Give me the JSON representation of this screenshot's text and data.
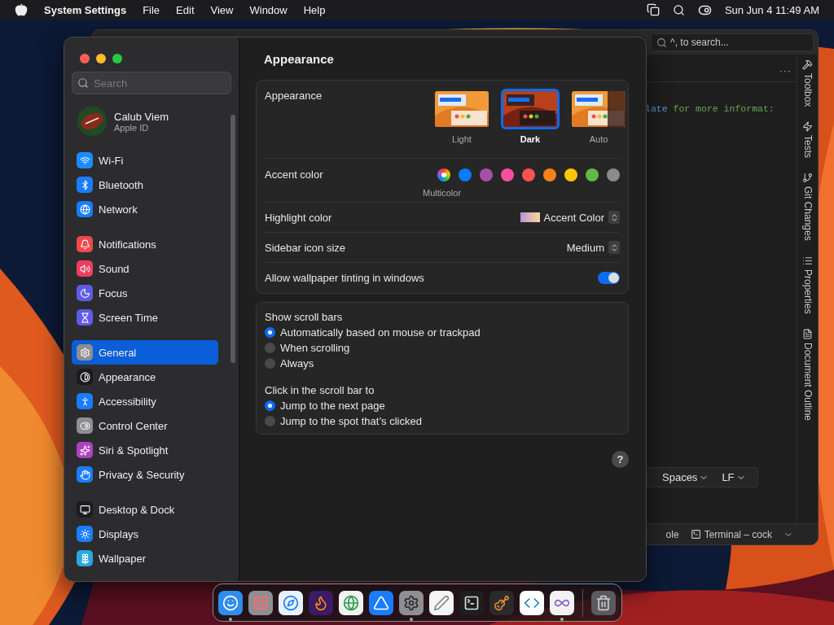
{
  "menubar": {
    "app": "System Settings",
    "menus": [
      "File",
      "Edit",
      "View",
      "Window",
      "Help"
    ],
    "clock": "Sun Jun 4  11:49 AM"
  },
  "ide": {
    "search_placeholder": "^, to search...",
    "more": "···",
    "code": [
      {
        "text": "late",
        "kind": "keyword"
      },
      {
        "text": " for more informat:",
        "kind": "string"
      }
    ],
    "side_tabs": [
      {
        "label": "Toolbox",
        "kind": "toolbox"
      },
      {
        "label": "Tests",
        "kind": "tests"
      },
      {
        "label": "Git Changes",
        "kind": "git"
      },
      {
        "label": "Properties",
        "kind": "properties"
      },
      {
        "label": "Document Outline",
        "kind": "outline"
      }
    ],
    "status": [
      "Spaces",
      "LF"
    ],
    "bottom_tabs": [
      {
        "label": "ole",
        "kind": "plain"
      },
      {
        "label": "Terminal – cock",
        "kind": "terminal"
      }
    ]
  },
  "settings": {
    "search_placeholder": "Search",
    "account": {
      "name": "Calub Viem",
      "subtitle": "Apple ID"
    },
    "sidebar_groups": [
      [
        {
          "label": "Wi-Fi",
          "kind": "wifi",
          "selected": false
        },
        {
          "label": "Bluetooth",
          "kind": "bluetooth",
          "selected": false
        },
        {
          "label": "Network",
          "kind": "network",
          "selected": false
        }
      ],
      [
        {
          "label": "Notifications",
          "kind": "notifications",
          "selected": false
        },
        {
          "label": "Sound",
          "kind": "sound",
          "selected": false
        },
        {
          "label": "Focus",
          "kind": "focus",
          "selected": false
        },
        {
          "label": "Screen Time",
          "kind": "screentime",
          "selected": false
        }
      ],
      [
        {
          "label": "General",
          "kind": "general",
          "selected": true
        },
        {
          "label": "Appearance",
          "kind": "appearance",
          "selected": false
        },
        {
          "label": "Accessibility",
          "kind": "accessibility",
          "selected": false
        },
        {
          "label": "Control Center",
          "kind": "control",
          "selected": false
        },
        {
          "label": "Siri & Spotlight",
          "kind": "siri",
          "selected": false
        },
        {
          "label": "Privacy & Security",
          "kind": "privacy",
          "selected": false
        }
      ],
      [
        {
          "label": "Desktop & Dock",
          "kind": "desktop",
          "selected": false
        },
        {
          "label": "Displays",
          "kind": "displays",
          "selected": false
        },
        {
          "label": "Wallpaper",
          "kind": "wallpaper",
          "selected": false
        }
      ]
    ],
    "title": "Appearance",
    "appearance": {
      "label": "Appearance",
      "options": [
        {
          "label": "Light",
          "kind": "light",
          "selected": false
        },
        {
          "label": "Dark",
          "kind": "dark",
          "selected": true
        },
        {
          "label": "Auto",
          "kind": "auto",
          "selected": false
        }
      ]
    },
    "accent": {
      "label": "Accent color",
      "caption": "Multicolor",
      "colors": [
        {
          "kind": "multicolor",
          "selected": true
        },
        {
          "kind": "solid",
          "color": "#0a7cff",
          "selected": false
        },
        {
          "kind": "solid",
          "color": "#a550a7",
          "selected": false
        },
        {
          "kind": "solid",
          "color": "#f74f9e",
          "selected": false
        },
        {
          "kind": "solid",
          "color": "#ff5257",
          "selected": false
        },
        {
          "kind": "solid",
          "color": "#f7821b",
          "selected": false
        },
        {
          "kind": "solid",
          "color": "#ffc600",
          "selected": false
        },
        {
          "kind": "solid",
          "color": "#62ba46",
          "selected": false
        },
        {
          "kind": "solid",
          "color": "#8c8c8c",
          "selected": false
        }
      ]
    },
    "highlight": {
      "label": "Highlight color",
      "value": "Accent Color"
    },
    "icon_size": {
      "label": "Sidebar icon size",
      "value": "Medium"
    },
    "tinting": {
      "label": "Allow wallpaper tinting in windows",
      "on": true
    },
    "scroll_bars": {
      "label": "Show scroll bars",
      "options": [
        {
          "label": "Automatically based on mouse or trackpad",
          "selected": true
        },
        {
          "label": "When scrolling",
          "selected": false
        },
        {
          "label": "Always",
          "selected": false
        }
      ]
    },
    "click_scroll": {
      "label": "Click in the scroll bar to",
      "options": [
        {
          "label": "Jump to the next page",
          "selected": true
        },
        {
          "label": "Jump to the spot that’s clicked",
          "selected": false
        }
      ]
    },
    "help": "?"
  },
  "dock": [
    {
      "kind": "finder",
      "running": true
    },
    {
      "kind": "launchpad",
      "running": false
    },
    {
      "kind": "safari",
      "running": false
    },
    {
      "kind": "firefox",
      "running": false
    },
    {
      "kind": "chrome",
      "running": false
    },
    {
      "kind": "appstore",
      "running": false
    },
    {
      "kind": "settings",
      "running": true
    },
    {
      "kind": "textedit",
      "running": false
    },
    {
      "kind": "terminal",
      "running": false
    },
    {
      "kind": "garageband",
      "running": false
    },
    {
      "kind": "vscode",
      "running": false
    },
    {
      "kind": "visualstudio",
      "running": true
    },
    {
      "kind": "separator"
    },
    {
      "kind": "trash",
      "running": false
    }
  ]
}
